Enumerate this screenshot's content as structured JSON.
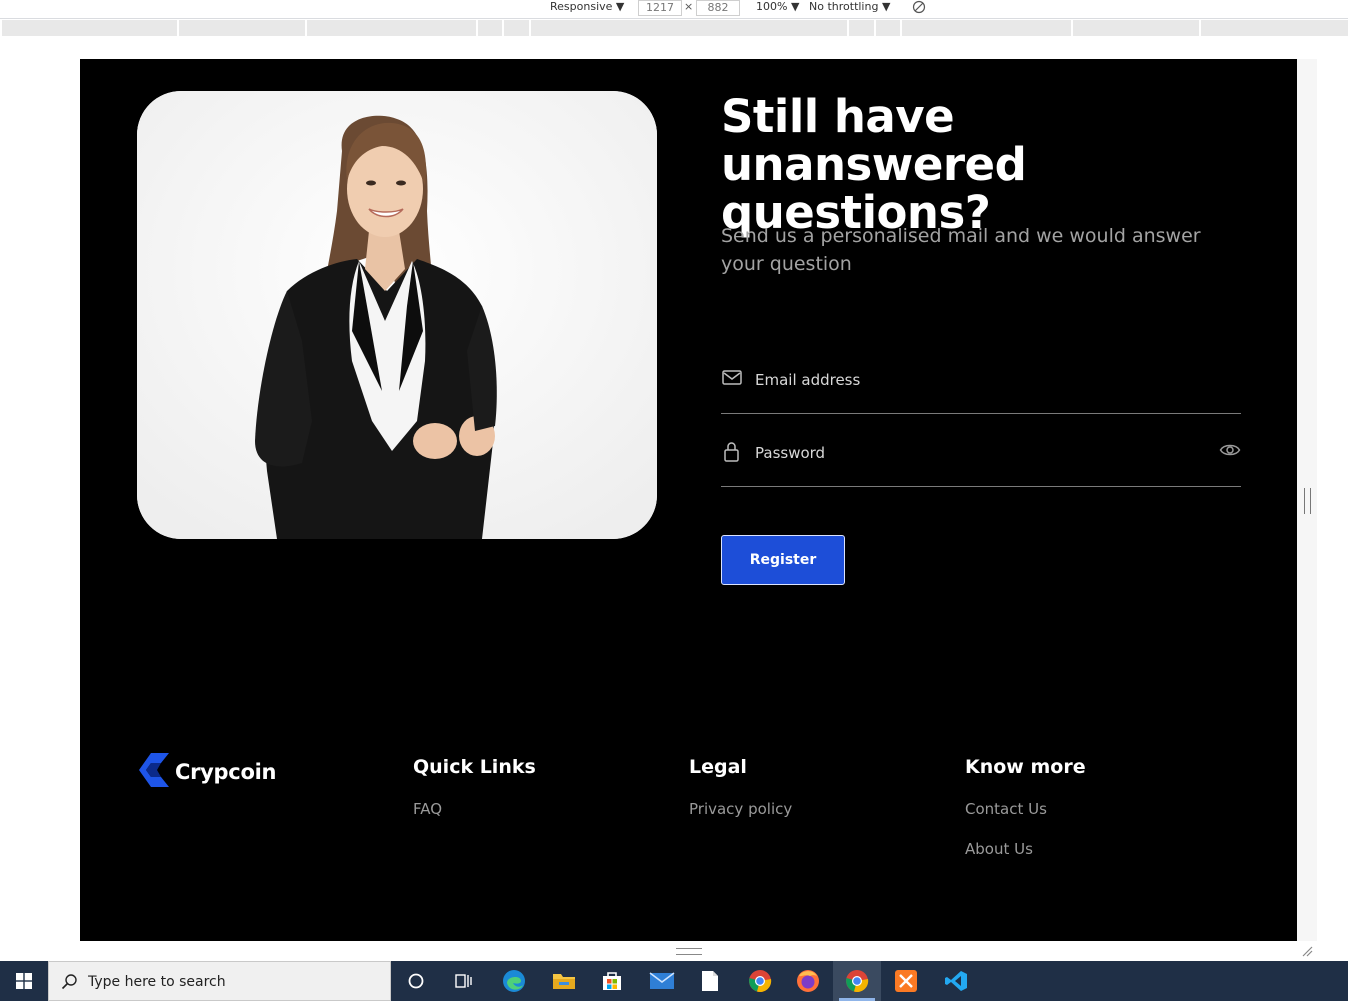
{
  "devtools": {
    "device": "Responsive ▼",
    "width": "1217",
    "times": "×",
    "height": "882",
    "zoom": "100% ▼",
    "throttling": "No throttling ▼",
    "rotate_icon": "rotate-icon"
  },
  "page": {
    "headline": "Still have unanswered questions?",
    "subtext": "Send us a personalised mail and we would answer your question",
    "form": {
      "email_placeholder": "Email address",
      "email_value": "",
      "password_placeholder": "Password",
      "password_value": "",
      "register_label": "Register"
    },
    "footer": {
      "brand": "Crypcoin",
      "columns": [
        {
          "title": "Quick Links",
          "links": [
            "FAQ"
          ]
        },
        {
          "title": "Legal",
          "links": [
            "Privacy policy"
          ]
        },
        {
          "title": "Know more",
          "links": [
            "Contact Us",
            "About Us"
          ]
        }
      ]
    },
    "colors": {
      "accent": "#1d4ed8",
      "background": "#000000",
      "muted_text": "#a3a3a3"
    }
  },
  "taskbar": {
    "search_placeholder": "Type here to search",
    "icons": [
      "windows-start-icon",
      "cortana-icon",
      "task-view-icon",
      "edge-icon",
      "file-explorer-icon",
      "microsoft-store-icon",
      "mail-icon",
      "notepad-icon",
      "chrome-icon",
      "firefox-icon",
      "chrome-active-icon",
      "xampp-icon",
      "vscode-icon"
    ]
  }
}
